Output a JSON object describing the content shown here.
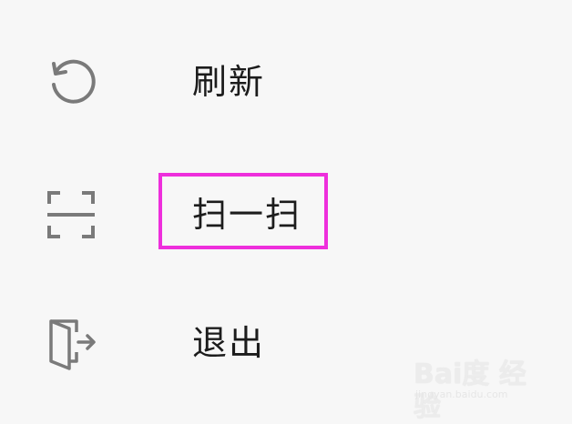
{
  "menu": {
    "items": [
      {
        "label": "刷新",
        "icon": "refresh-icon"
      },
      {
        "label": "扫一扫",
        "icon": "scan-icon",
        "highlighted": true
      },
      {
        "label": "退出",
        "icon": "exit-door-icon"
      }
    ]
  },
  "colors": {
    "background": "#f7f7f7",
    "text": "#1c1c1c",
    "icon": "#7a7a7a",
    "highlight": "#ee2fdc"
  },
  "watermark": {
    "text": "Bai度 经验",
    "sub": "jingyan.baidu.com"
  }
}
